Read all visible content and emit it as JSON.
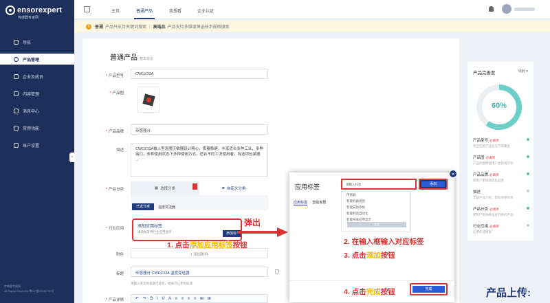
{
  "logo": {
    "name": "ensorexpert",
    "sub": "传感器专家网"
  },
  "sidebar": {
    "items": [
      "导航",
      "产品管理",
      "企业及成员",
      "内容管理",
      "消息中心",
      "常用功能",
      "账户设置"
    ],
    "active_index": 1,
    "footer1": "传感器专家网",
    "footer2": "All Rights Reserved 粤ICP备19082759号"
  },
  "topbar": {
    "tabs": [
      "主页",
      "普通产品",
      "我想看",
      "企业认证"
    ],
    "active_index": 1
  },
  "notice": {
    "label1": "普通",
    "text1": "产品只支持关键词搜索",
    "label2": "高端品",
    "text2": "产品支持多维度筛选技术规格搜索"
  },
  "form": {
    "title": "普通产品",
    "subtitle": "基本信息",
    "model_label": "产品型号",
    "model_value": "CWDZ33A",
    "image_label": "产品图",
    "brand_label": "产品品牌",
    "brand_value": "传感器分",
    "desc_label": "描述",
    "desc_value": "CWDZ33A嵌入型温度压敏器设计精心，质量稳健，丰富适合多种工业，多种接口，多种使用状态下多种使用方式，适合不同工况使用者，有选项包装器→",
    "category_label": "产品分类",
    "cat_tab_select": "选择分类",
    "cat_tab_custom": "自定义分类",
    "cat_pill": "已选分类",
    "cat_selected": "温度变送器",
    "industry_label": "行业应用",
    "app_tag_title": "添加应用标签",
    "app_tag_hint": "请添加支持行业应用显示",
    "app_tag_btn": "添加标签",
    "attach_label": "附件",
    "attach_value": "添加附件",
    "headline_label": "标题",
    "headline_value": "传感器分 CWDZ33A 温度变送器",
    "headline_hint": "请输入真实的标题内容后，相关可以参照标题",
    "editor_label": "产品详情",
    "editor_tools": "↶ ↷ B I U A ≡ ≡ ≡ ≡ ⊞ ⊞"
  },
  "right_panel": {
    "title": "产品完善度",
    "more": "收起",
    "percent": "60%",
    "percent_value": 60,
    "items": [
      {
        "name": "产品型号",
        "tag": "必填项",
        "desc": "完全匹配产品型号不得重复",
        "done": true
      },
      {
        "name": "产品图",
        "tag": "必填项",
        "desc": "产品的图像使用户更容易识别",
        "done": true
      },
      {
        "name": "产品品牌",
        "tag": "必填项",
        "desc": "使用户更快速定位品牌",
        "done": true
      },
      {
        "name": "描述",
        "tag": "",
        "desc": "丰富产品介绍，帮助你更好地",
        "done": false
      },
      {
        "name": "产品分类",
        "tag": "必填项",
        "desc": "使用户更快精准找到你的产品",
        "done": true
      },
      {
        "name": "行业应用",
        "tag": "必填项",
        "desc": "应用标签搜索",
        "done": false
      }
    ]
  },
  "modal": {
    "title": "应用标签",
    "search_placeholder": "请输入标签",
    "add_label": "添加",
    "tabs": [
      "应用标签",
      "智能家居"
    ],
    "options": [
      "传感器",
      "智能机器视觉",
      "智能安防系统",
      "智能制造自动化",
      "智能驾驶应用显示"
    ],
    "ok_label": "完成",
    "done_label": "完成"
  },
  "annotations": {
    "pop": "弹出",
    "step1a": "1. 点击",
    "step1b": "添加应用标签",
    "step1c": "按钮",
    "step2": "2. 在输入框输入对应标签",
    "step3a": "3. 点击",
    "step3b": "添加",
    "step3c": "按钮",
    "step4a": "4. 点击",
    "step4b": "完成",
    "step4c": "按钮",
    "upload": "产品上传:"
  },
  "colors": {
    "sidebar": "#1e2f5c",
    "accent": "#1e3a7a",
    "highlight": "#d93535",
    "progress": "#6ecfca"
  }
}
